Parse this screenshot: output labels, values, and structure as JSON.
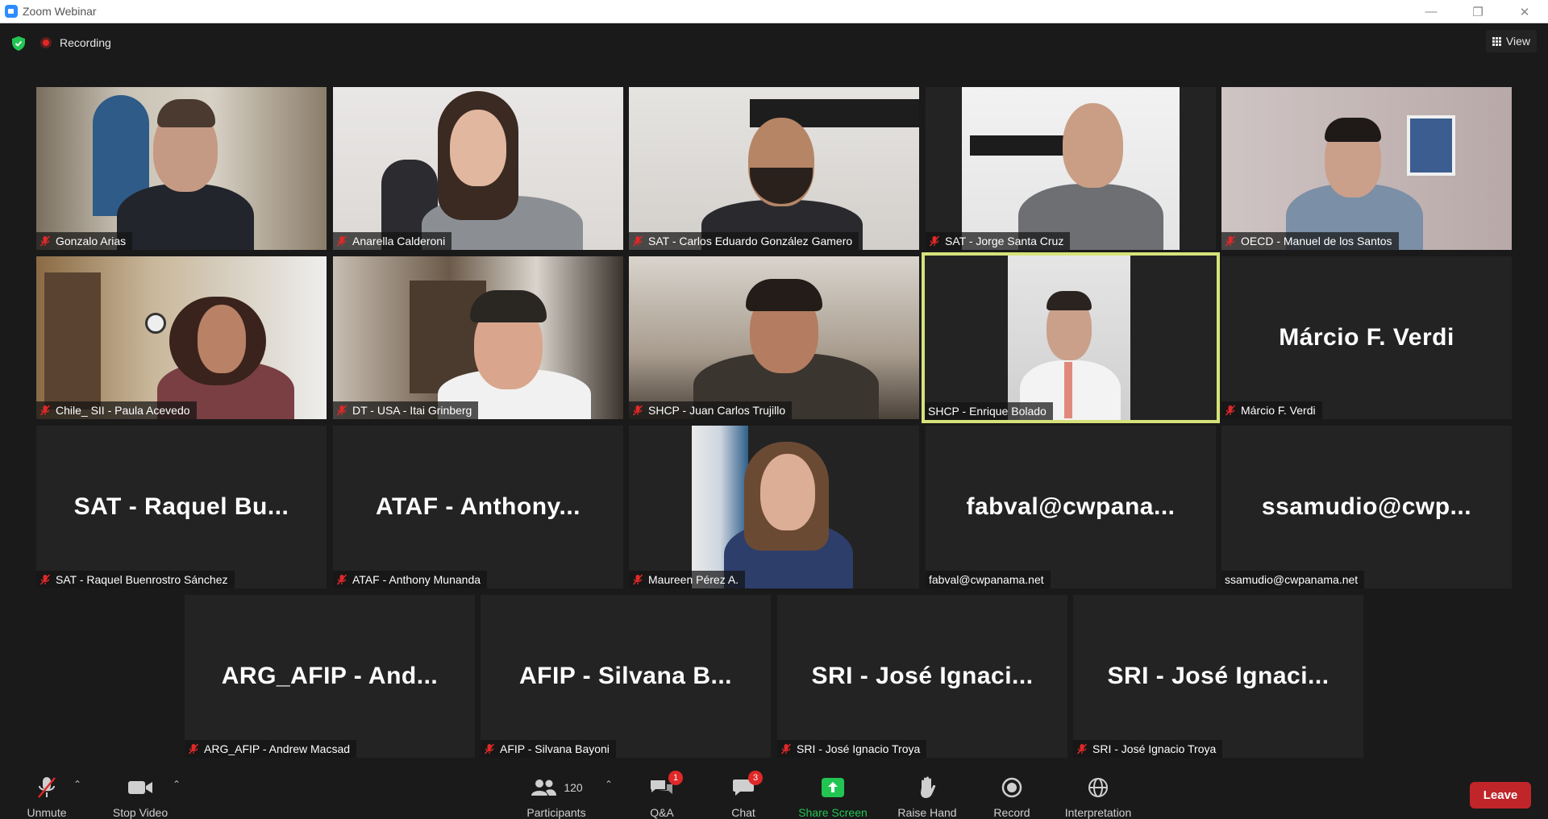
{
  "window": {
    "title": "Zoom Webinar"
  },
  "topbar": {
    "recording_label": "Recording",
    "view_label": "View"
  },
  "participants": [
    {
      "name": "Gonzalo Arias",
      "label": "Gonzalo Arias",
      "muted": true
    },
    {
      "name": "Anarella Calderoni",
      "label": "Anarella Calderoni",
      "muted": true
    },
    {
      "name": "SAT - Carlos Eduardo González Gamero",
      "label": "SAT - Carlos Eduardo González Gamero",
      "muted": true
    },
    {
      "name": "SAT - Jorge Santa Cruz",
      "label": "SAT - Jorge Santa Cruz",
      "muted": true
    },
    {
      "name": "OECD - Manuel de los Santos",
      "label": "OECD - Manuel de los Santos",
      "muted": true
    },
    {
      "name": "Chile_ SII - Paula Acevedo",
      "label": "Chile_ SII - Paula Acevedo",
      "muted": true
    },
    {
      "name": "DT - USA - Itai Grinberg",
      "label": "DT - USA - Itai Grinberg",
      "muted": true
    },
    {
      "name": "SHCP - Juan Carlos Trujillo",
      "label": "SHCP - Juan Carlos Trujillo",
      "muted": true
    },
    {
      "name": "SHCP - Enrique Bolado",
      "label": "SHCP - Enrique Bolado",
      "muted": false,
      "active_speaker": true
    },
    {
      "name": "Márcio F. Verdi",
      "label": "Márcio F. Verdi",
      "big": "Márcio F. Verdi",
      "muted": true
    },
    {
      "name": "SAT - Raquel Buenrostro Sánchez",
      "label": "SAT - Raquel Buenrostro Sánchez",
      "big": "SAT - Raquel Bu...",
      "muted": true
    },
    {
      "name": "ATAF - Anthony Munanda",
      "label": "ATAF - Anthony Munanda",
      "big": "ATAF - Anthony...",
      "muted": true
    },
    {
      "name": "Maureen Pérez A.",
      "label": "Maureen Pérez A.",
      "muted": true
    },
    {
      "name": "fabval@cwpanama.net",
      "label": "fabval@cwpanama.net",
      "big": "fabval@cwpana...",
      "muted": false
    },
    {
      "name": "ssamudio@cwpanama.net",
      "label": "ssamudio@cwpanama.net",
      "big": "ssamudio@cwp...",
      "muted": false
    },
    {
      "name": "ARG_AFIP - Andrew Macsad",
      "label": "ARG_AFIP - Andrew Macsad",
      "big": "ARG_AFIP - And...",
      "muted": true
    },
    {
      "name": "AFIP - Silvana Bayoni",
      "label": "AFIP - Silvana Bayoni",
      "big": "AFIP - Silvana B...",
      "muted": true
    },
    {
      "name": "SRI - José Ignacio Troya",
      "label": "SRI - José Ignacio Troya",
      "big": "SRI - José Ignaci...",
      "muted": true
    },
    {
      "name": "SRI - José Ignacio Troya",
      "label": "SRI - José Ignacio Troya",
      "big": "SRI - José Ignaci...",
      "muted": true
    }
  ],
  "toolbar": {
    "unmute": "Unmute",
    "stop_video": "Stop Video",
    "participants": "Participants",
    "participant_count": "120",
    "qa": "Q&A",
    "qa_badge": "1",
    "chat": "Chat",
    "chat_badge": "3",
    "share_screen": "Share Screen",
    "raise_hand": "Raise Hand",
    "record": "Record",
    "interpretation": "Interpretation",
    "leave": "Leave"
  },
  "colors": {
    "accent_green": "#23c552",
    "danger": "#e02828",
    "active_border": "#d6e27a",
    "background": "#1a1a1a"
  }
}
